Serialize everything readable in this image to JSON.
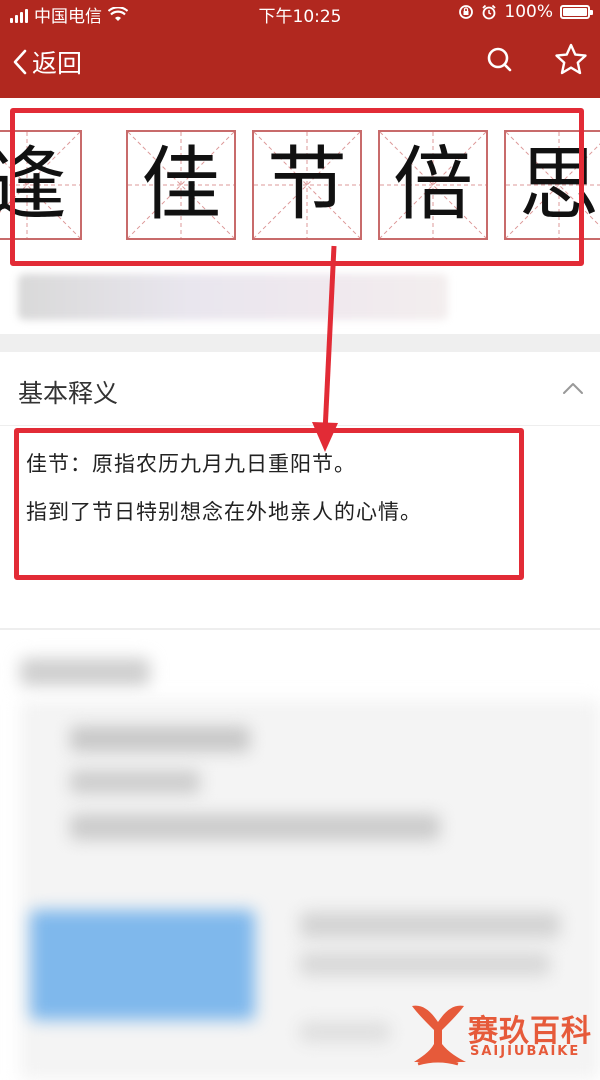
{
  "status_bar": {
    "carrier": "中国电信",
    "time": "下午10:25",
    "battery": "100%"
  },
  "nav": {
    "back_label": "返回"
  },
  "title": {
    "characters": [
      "逢",
      "佳",
      "节",
      "倍",
      "思"
    ]
  },
  "basic_meaning": {
    "section_title": "基本释义",
    "lines": [
      "佳节：原指农历九月九日重阳节。",
      "指到了节日特别想念在外地亲人的心情。"
    ]
  },
  "watermark": {
    "name": "赛玖百科",
    "latin": "SAIJIUBAIKE"
  },
  "colors": {
    "header_red": "#b1281f",
    "annotation_red": "#e22b36",
    "grid_red": "#c86b6b",
    "watermark_orange": "#e65a3a"
  }
}
